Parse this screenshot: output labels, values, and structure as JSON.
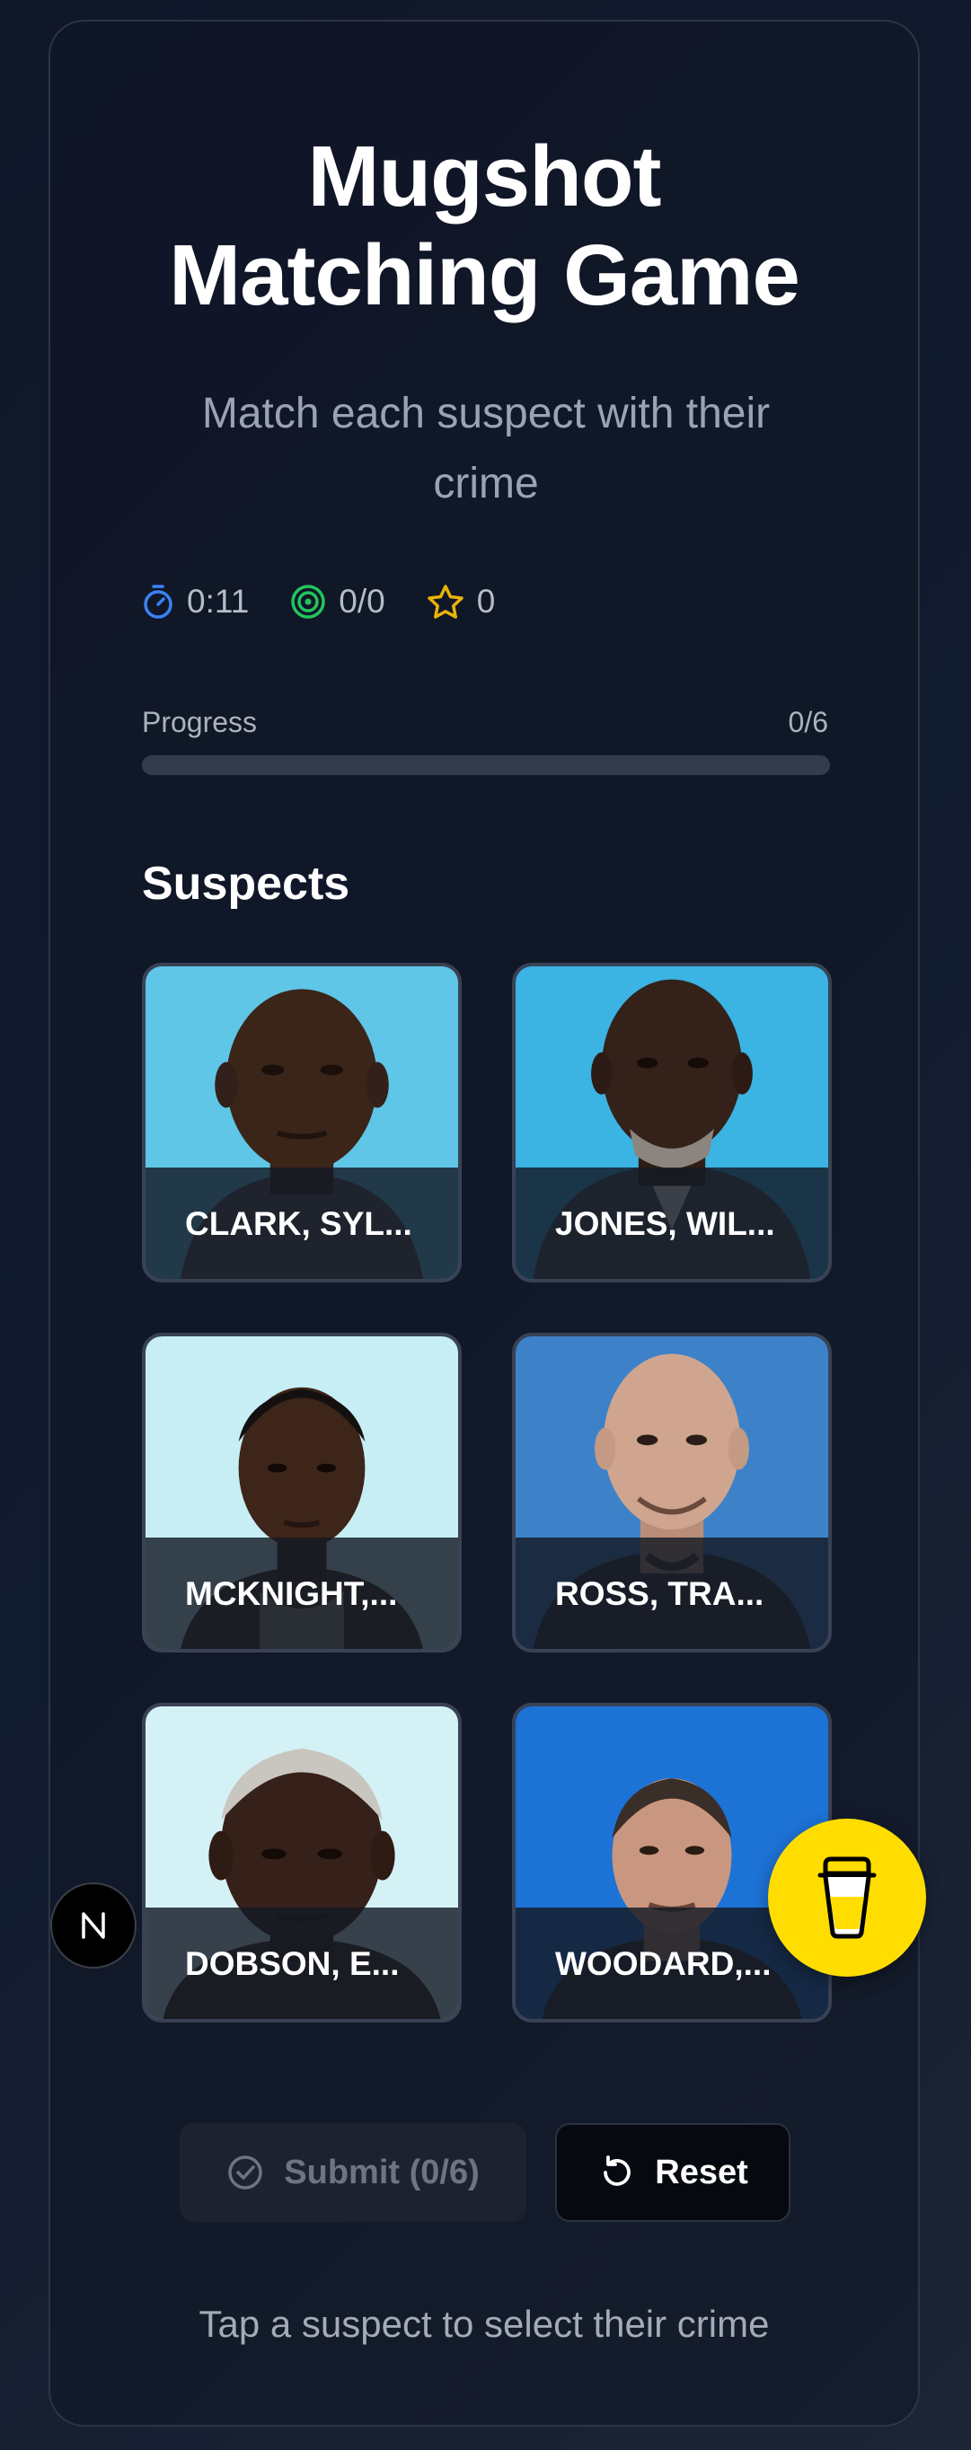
{
  "header": {
    "title_line1": "Mugshot",
    "title_line2": "Matching Game",
    "subtitle": "Match each suspect with their crime"
  },
  "stats": {
    "timer": "0:11",
    "matches": "0/0",
    "score": "0",
    "timer_icon": "timer-icon",
    "target_icon": "target-icon",
    "star_icon": "star-icon"
  },
  "progress": {
    "label": "Progress",
    "count": "0/6",
    "fraction": 0
  },
  "suspects": {
    "heading": "Suspects",
    "items": [
      {
        "name": "CLARK, SYL..."
      },
      {
        "name": "JONES, WIL..."
      },
      {
        "name": "MCKNIGHT,..."
      },
      {
        "name": "ROSS, TRA..."
      },
      {
        "name": "DOBSON, E..."
      },
      {
        "name": "WOODARD,..."
      }
    ]
  },
  "actions": {
    "submit_label": "Submit (0/6)",
    "reset_label": "Reset"
  },
  "hint": "Tap a suspect to select their crime",
  "colors": {
    "background": "#0f1729",
    "accent_timer": "#3b82f6",
    "accent_target": "#22c55e",
    "accent_star": "#eab308",
    "coffee_button": "#ffdd00"
  }
}
